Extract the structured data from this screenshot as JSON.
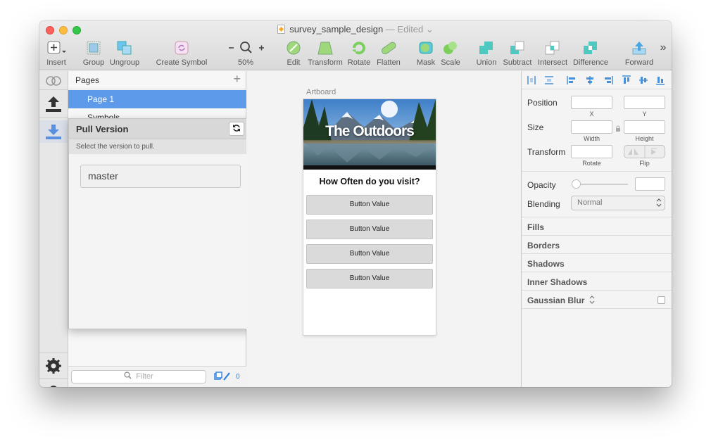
{
  "window": {
    "title": "survey_sample_design",
    "edited": "— Edited ⌄"
  },
  "toolbar": {
    "insert": "Insert",
    "group": "Group",
    "ungroup": "Ungroup",
    "create_symbol": "Create Symbol",
    "zoom": "50%",
    "zoom_minus": "−",
    "zoom_plus": "+",
    "edit": "Edit",
    "transform": "Transform",
    "rotate": "Rotate",
    "flatten": "Flatten",
    "mask": "Mask",
    "scale": "Scale",
    "union": "Union",
    "subtract": "Subtract",
    "intersect": "Intersect",
    "difference": "Difference",
    "forward": "Forward",
    "more": "»"
  },
  "layers": {
    "pages_label": "Pages",
    "add": "+",
    "pages": [
      "Page 1",
      "Symbols"
    ],
    "filter_placeholder": "Filter",
    "filter_count": "0"
  },
  "popover": {
    "title": "Pull Version",
    "subtitle": "Select the version to pull.",
    "branch": "master"
  },
  "artboard": {
    "label": "Artboard",
    "hero_title": "The Outdoors",
    "question": "How Often do you visit?",
    "buttons": [
      "Button Value",
      "Button Value",
      "Button Value",
      "Button Value"
    ]
  },
  "inspector": {
    "position": "Position",
    "x": "X",
    "y": "Y",
    "size": "Size",
    "width": "Width",
    "height": "Height",
    "transform": "Transform",
    "rotate": "Rotate",
    "flip": "Flip",
    "opacity": "Opacity",
    "blending": "Blending",
    "blending_value": "Normal",
    "fills": "Fills",
    "borders": "Borders",
    "shadows": "Shadows",
    "inner_shadows": "Inner Shadows",
    "gaussian_blur": "Gaussian Blur"
  },
  "colors": {
    "selection": "#5d9bea",
    "accent_icon": "#4fc8c0",
    "rail_icon_active": "#5b8fdf"
  }
}
